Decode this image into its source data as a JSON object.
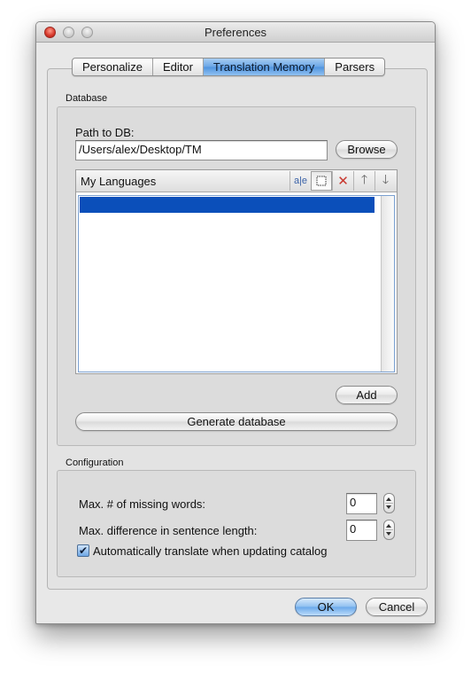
{
  "window": {
    "title": "Preferences"
  },
  "tabs": [
    {
      "label": "Personalize"
    },
    {
      "label": "Editor"
    },
    {
      "label": "Translation Memory"
    },
    {
      "label": "Parsers"
    }
  ],
  "active_tab": "Translation Memory",
  "database": {
    "group_label": "Database",
    "path_label": "Path to DB:",
    "path_value": "/Users/alex/Desktop/TM",
    "browse_label": "Browse",
    "languages_header": "My Languages",
    "language_rows": [
      {
        "label": "",
        "selected": true
      }
    ],
    "add_label": "Add",
    "generate_label": "Generate database"
  },
  "header_icons": [
    "text-edit-icon",
    "note-icon",
    "delete-x-icon",
    "arrow-up-icon",
    "arrow-down-icon"
  ],
  "configuration": {
    "group_label": "Configuration",
    "missing_words_label": "Max. # of missing words:",
    "missing_words_value": "0",
    "sentence_diff_label": "Max. difference in sentence length:",
    "sentence_diff_value": "0",
    "auto_translate_label": "Automatically translate when updating catalog",
    "auto_translate_checked": true
  },
  "footer": {
    "ok_label": "OK",
    "cancel_label": "Cancel"
  },
  "colors": {
    "selection": "#0b4fba",
    "accent": "#6aa8ea",
    "close_button": "#d6372a"
  }
}
